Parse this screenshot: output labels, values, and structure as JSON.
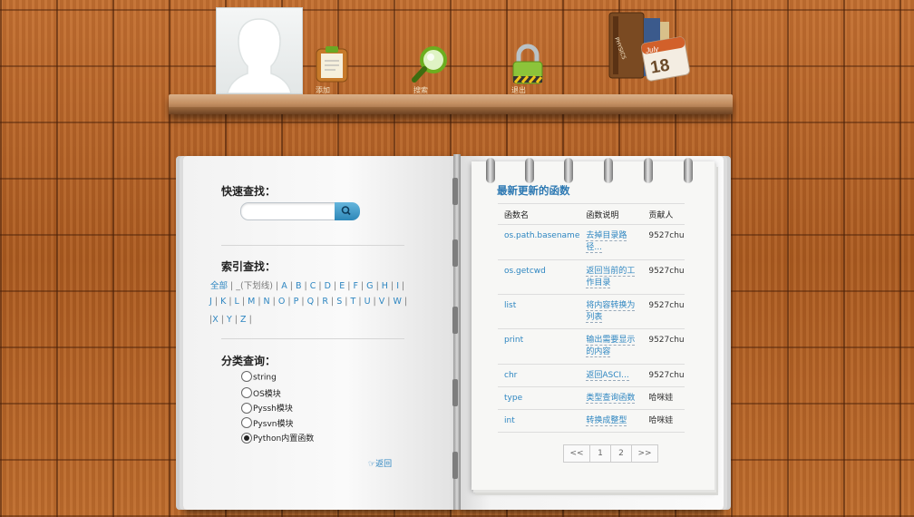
{
  "shelf": {
    "items": [
      {
        "icon": "clipboard-icon",
        "label": "添加"
      },
      {
        "icon": "magnifier-icon",
        "label": "搜索"
      },
      {
        "icon": "lock-icon",
        "label": "退出"
      }
    ],
    "books": {
      "spine_text": "PHYSICS",
      "calendar_month": "July",
      "calendar_day": "18"
    }
  },
  "left_page": {
    "quick_search": {
      "label": "快速查找：",
      "placeholder": ""
    },
    "index_search": {
      "label": "索引查找：",
      "row1_prefix": "全部 | _(下划线) | ",
      "letters_row1": [
        "A",
        "B",
        "C",
        "D",
        "E",
        "F",
        "G",
        "H",
        "I"
      ],
      "letters_row2": [
        "J",
        "K",
        "L",
        "M",
        "N",
        "O",
        "P",
        "Q",
        "R",
        "S",
        "T",
        "U",
        "V",
        "W"
      ],
      "letters_row3": [
        "X",
        "Y",
        "Z"
      ]
    },
    "category_search": {
      "label": "分类查询：",
      "options": [
        {
          "label": "string",
          "checked": false
        },
        {
          "label": "OS模块",
          "checked": false
        },
        {
          "label": "Pyssh模块",
          "checked": false
        },
        {
          "label": "Pysvn模块",
          "checked": false
        },
        {
          "label": "Python内置函数",
          "checked": true
        }
      ]
    },
    "back_link": "返回"
  },
  "right_page": {
    "title": "最新更新的函数",
    "columns": [
      "函数名",
      "函数说明",
      "贡献人"
    ],
    "rows": [
      {
        "name": "os.path.basename",
        "desc1": "去掉目录路",
        "desc2": "径...",
        "by": "9527chu"
      },
      {
        "name": "os.getcwd",
        "desc1": "返回当前的工",
        "desc2": "作目录",
        "by": "9527chu"
      },
      {
        "name": "list",
        "desc1": "将内容转换为",
        "desc2": "列表",
        "by": "9527chu"
      },
      {
        "name": "print",
        "desc1": "输出需要显示",
        "desc2": "的内容",
        "by": "9527chu"
      },
      {
        "name": "chr",
        "desc1": "返回ASCI...",
        "desc2": "",
        "by": "9527chu"
      },
      {
        "name": "type",
        "desc1": "类型查询函数",
        "desc2": "",
        "by": "哈咪娃"
      },
      {
        "name": "int",
        "desc1": "转换成整型",
        "desc2": "",
        "by": "哈咪娃"
      }
    ],
    "pager": [
      "<<",
      "1",
      "2",
      ">>"
    ]
  }
}
